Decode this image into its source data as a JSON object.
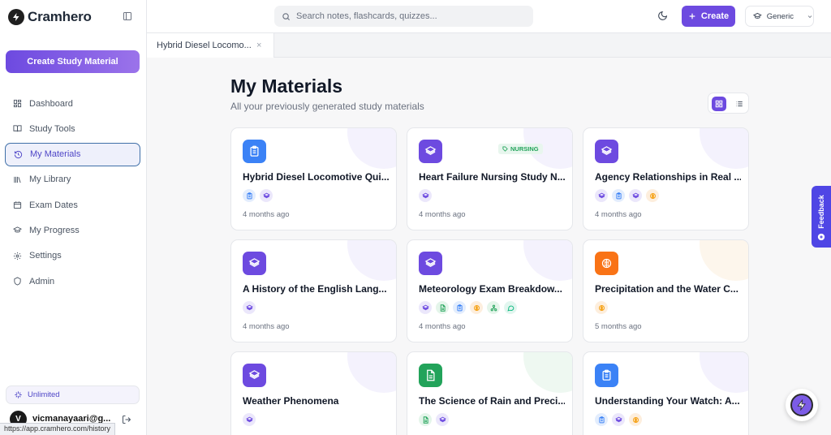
{
  "app": {
    "name": "Cramhero"
  },
  "sidebar": {
    "create_label": "Create Study Material",
    "items": [
      {
        "label": "Dashboard",
        "icon": "dashboard-icon"
      },
      {
        "label": "Study Tools",
        "icon": "book-icon"
      },
      {
        "label": "My Materials",
        "icon": "history-icon",
        "active": true
      },
      {
        "label": "My Library",
        "icon": "library-icon"
      },
      {
        "label": "Exam Dates",
        "icon": "calendar-icon"
      },
      {
        "label": "My Progress",
        "icon": "graduation-cap-icon"
      },
      {
        "label": "Settings",
        "icon": "gear-icon"
      },
      {
        "label": "Admin",
        "icon": "shield-icon"
      }
    ],
    "plan_label": "Unlimited",
    "user_initial": "V",
    "user_email": "vicmanayaari@g..."
  },
  "status_url": "https://app.cramhero.com/history",
  "header": {
    "search_placeholder": "Search notes, flashcards, quizzes...",
    "create_label": "Create",
    "mode_label": "Generic"
  },
  "tabs": [
    {
      "label": "Hybrid Diesel Locomo...",
      "close": "×"
    }
  ],
  "main": {
    "title": "My Materials",
    "subtitle": "All your previously generated study materials"
  },
  "cards": [
    {
      "title": "Hybrid Diesel Locomotive Qui...",
      "time": "4 months ago",
      "icon": "clipboard-icon",
      "color": "#3b82f6",
      "badges": [
        "clipboard",
        "layers"
      ]
    },
    {
      "title": "Heart Failure Nursing Study N...",
      "time": "4 months ago",
      "icon": "layers-icon",
      "color": "#6d4ae0",
      "tag": "NURSING",
      "badges": [
        "layers"
      ]
    },
    {
      "title": "Agency Relationships in Real ...",
      "time": "4 months ago",
      "icon": "layers-icon",
      "color": "#6d4ae0",
      "badges": [
        "layers",
        "clipboard",
        "layers",
        "brain"
      ]
    },
    {
      "title": "A History of the English Lang...",
      "time": "4 months ago",
      "icon": "layers-icon",
      "color": "#6d4ae0",
      "badges": [
        "layers"
      ]
    },
    {
      "title": "Meteorology Exam Breakdow...",
      "time": "4 months ago",
      "icon": "layers-icon",
      "color": "#6d4ae0",
      "badges": [
        "layers",
        "doc",
        "clipboard",
        "brain",
        "mindmap",
        "chat"
      ]
    },
    {
      "title": "Precipitation and the Water C...",
      "time": "5 months ago",
      "icon": "brain-icon",
      "color": "#f97316",
      "badges": [
        "brain"
      ]
    },
    {
      "title": "Weather Phenomena",
      "time": "",
      "icon": "layers-icon",
      "color": "#6d4ae0",
      "badges": [
        "layers"
      ]
    },
    {
      "title": "The Science of Rain and Preci...",
      "time": "",
      "icon": "document-icon",
      "color": "#22a35a",
      "badges": [
        "doc",
        "layers"
      ]
    },
    {
      "title": "Understanding Your Watch: A...",
      "time": "",
      "icon": "clipboard-icon",
      "color": "#3b82f6",
      "badges": [
        "clipboard",
        "layers",
        "brain"
      ]
    }
  ],
  "feedback_label": "Feedback"
}
